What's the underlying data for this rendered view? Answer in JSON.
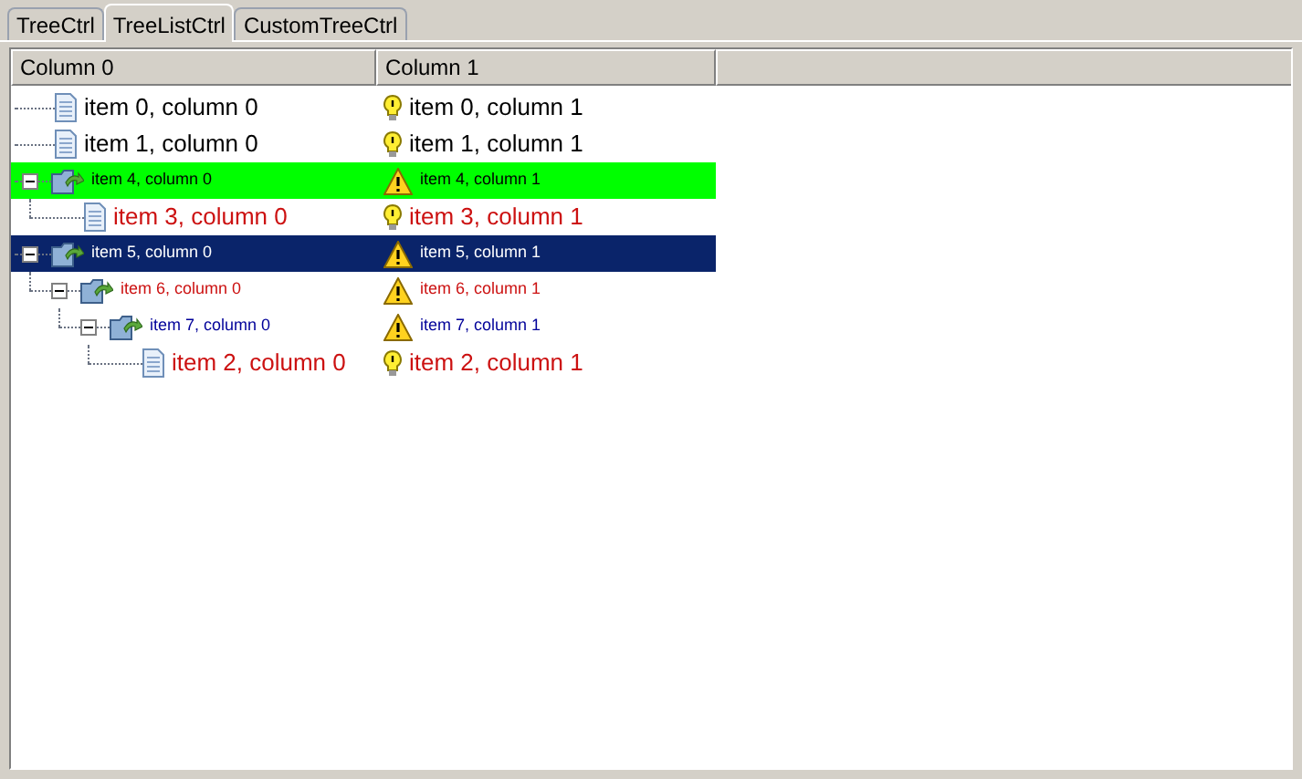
{
  "tabs": [
    {
      "label": "TreeCtrl",
      "selected": false
    },
    {
      "label": "TreeListCtrl",
      "selected": true
    },
    {
      "label": "CustomTreeCtrl",
      "selected": false
    }
  ],
  "columns": [
    "Column 0",
    "Column 1"
  ],
  "items": [
    {
      "kind": "document",
      "label": "item 0, column 0",
      "column_1": "item 0, column 1",
      "color": "#000000",
      "selected": false
    },
    {
      "kind": "document",
      "label": "item 1, column 0",
      "column_1": "item 1, column 1",
      "color": "#000000",
      "selected": false
    },
    {
      "kind": "folder",
      "label": "item 4, column 0",
      "column_1": "item 4, column 1",
      "color": "#000000",
      "highlighted": true,
      "selected": false,
      "expanded": true,
      "children": [
        {
          "kind": "document",
          "label": "item 3, column 0",
          "column_1": "item 3, column 1",
          "color": "#cc1111",
          "selected": false
        }
      ]
    },
    {
      "kind": "folder",
      "label": "item 5, column 0",
      "column_1": "item 5, column 1",
      "color": "#ffffff",
      "selected": true,
      "expanded": true,
      "children": [
        {
          "kind": "folder",
          "label": "item 6, column 0",
          "column_1": "item 6, column 1",
          "color": "#cc1111",
          "selected": false,
          "expanded": true,
          "children": [
            {
              "kind": "folder",
              "label": "item 7, column 0",
              "column_1": "item 7, column 1",
              "color": "#000099",
              "selected": false,
              "expanded": true,
              "children": [
                {
                  "kind": "document",
                  "label": "item 2, column 0",
                  "column_1": "item 2, column 1",
                  "color": "#cc1111",
                  "selected": false
                }
              ]
            }
          ]
        }
      ]
    }
  ]
}
